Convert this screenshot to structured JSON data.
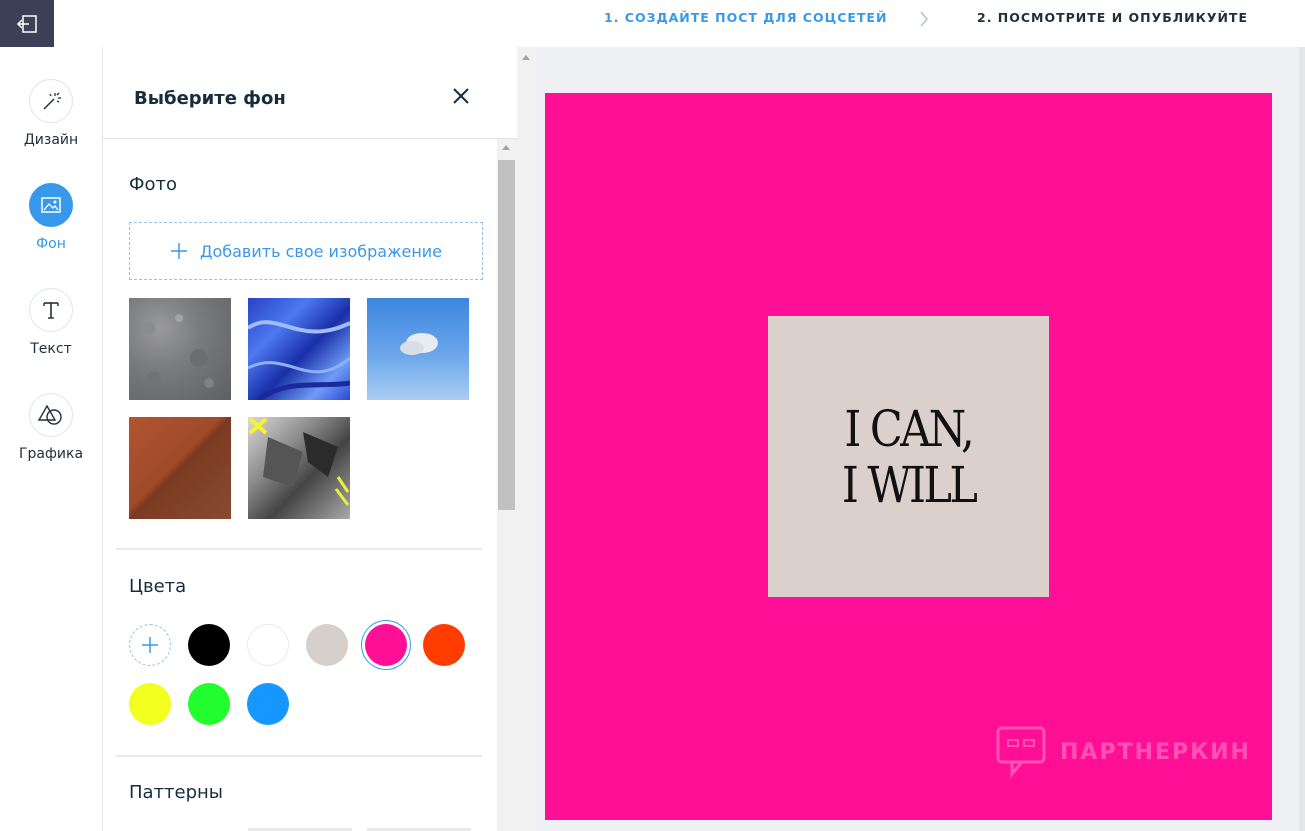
{
  "topbar": {
    "step1": "1. СОЗДАЙТЕ ПОСТ ДЛЯ СОЦСЕТЕЙ",
    "step2": "2. ПОСМОТРИТЕ И ОПУБЛИКУЙТЕ"
  },
  "rail": {
    "items": [
      {
        "label": "Дизайн",
        "icon": "magic-wand-icon"
      },
      {
        "label": "Фон",
        "icon": "image-icon",
        "active": true
      },
      {
        "label": "Текст",
        "icon": "text-icon"
      },
      {
        "label": "Графика",
        "icon": "shapes-icon"
      }
    ]
  },
  "panel": {
    "title": "Выберите фон",
    "photo_section": "Фото",
    "add_image": "Добавить свое изображение",
    "colors_section": "Цвета",
    "patterns_section": "Паттерны",
    "photos": [
      "grey-concrete",
      "blue-marble",
      "sky-cloud",
      "rust-texture",
      "bw-collage"
    ],
    "colors": [
      "#000000",
      "#ffffff",
      "#d6d0cc",
      "#ff0f96",
      "#ff3d00",
      "#f2ff1f",
      "#21fd2d",
      "#1597ff"
    ],
    "selected_color": "#ff0f96"
  },
  "canvas": {
    "background": "#ff0f96",
    "card_color": "#dbd0cc",
    "line1": "I CAN,",
    "line2": "I WILL",
    "watermark": "ПАРТНЕРКИН"
  }
}
